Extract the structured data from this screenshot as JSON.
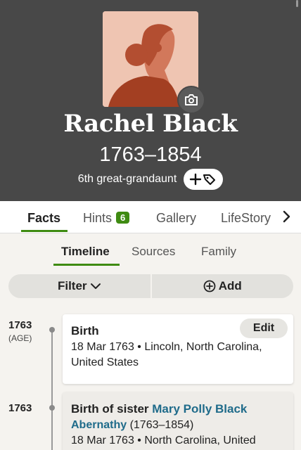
{
  "profile": {
    "name": "Rachel Black",
    "life_dates": "1763–1854",
    "relationship": "6th great-grandaunt",
    "portrait_colors": {
      "background": "#efc5b2",
      "face": "#d2785b",
      "hair": "#b34e31",
      "clothing": "#a33f22"
    }
  },
  "icons": {
    "photo": "camera-icon",
    "tag": "add-tag-icon",
    "next": "chevron-right-icon",
    "filter_caret": "chevron-down-icon",
    "add": "plus-circle-icon"
  },
  "tabs": [
    {
      "label": "Facts",
      "active": true
    },
    {
      "label": "Hints",
      "badge": "6"
    },
    {
      "label": "Gallery"
    },
    {
      "label": "LifeStory"
    }
  ],
  "subtabs": [
    {
      "label": "Timeline",
      "active": true
    },
    {
      "label": "Sources"
    },
    {
      "label": "Family"
    }
  ],
  "toolbar": {
    "filter_label": "Filter",
    "add_label": "Add"
  },
  "timeline": [
    {
      "year": "1763",
      "age": "(AGE)",
      "title": "Birth",
      "edit_label": "Edit",
      "date_place_line1": "18 Mar 1763 • Lincoln, North Carolina,",
      "date_place_line2": "United States"
    },
    {
      "year": "1763",
      "title_prefix": "Birth of sister ",
      "person_link_line1": "Mary Polly Black",
      "person_link_line2": "Abernathy",
      "person_dates": " (1763–1854)",
      "date_place_line1": "18 Mar 1763 • North Carolina, United"
    }
  ],
  "colors": {
    "accent": "#3f8b12",
    "link": "#1f6b8a",
    "header_bg": "#484848"
  }
}
